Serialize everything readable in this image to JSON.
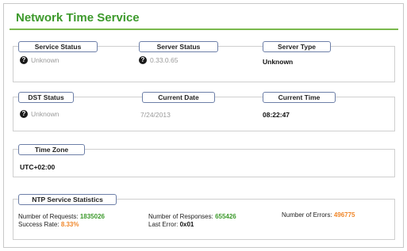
{
  "title": "Network Time Service",
  "service_group": {
    "service_status_label": "Service Status",
    "service_status_value": "Unknown",
    "server_status_label": "Server Status",
    "server_status_value": "0.33.0.65",
    "server_type_label": "Server Type",
    "server_type_value": "Unknown"
  },
  "dst_group": {
    "dst_status_label": "DST Status",
    "dst_status_value": "Unknown",
    "current_date_label": "Current Date",
    "current_date_value": "7/24/2013",
    "current_time_label": "Current Time",
    "current_time_value": "08:22:47"
  },
  "timezone_group": {
    "label": "Time Zone",
    "value": "UTC+02:00"
  },
  "ntp_stats": {
    "label": "NTP Service Statistics",
    "requests_label": "Number of Requests:",
    "requests_value": "1835026",
    "responses_label": "Number of Responses:",
    "responses_value": "655426",
    "errors_label": "Number of Errors:",
    "errors_value": "496775",
    "success_label": "Success Rate:",
    "success_value": "8.33%",
    "last_error_label": "Last Error:",
    "last_error_value": "0x01"
  },
  "icons": {
    "unknown_status": "question-circle-icon"
  },
  "colors": {
    "title_green": "#3d9a2c",
    "value_green": "#3d9a2c",
    "value_orange": "#f0872a",
    "legend_border": "#6d7fa8"
  }
}
